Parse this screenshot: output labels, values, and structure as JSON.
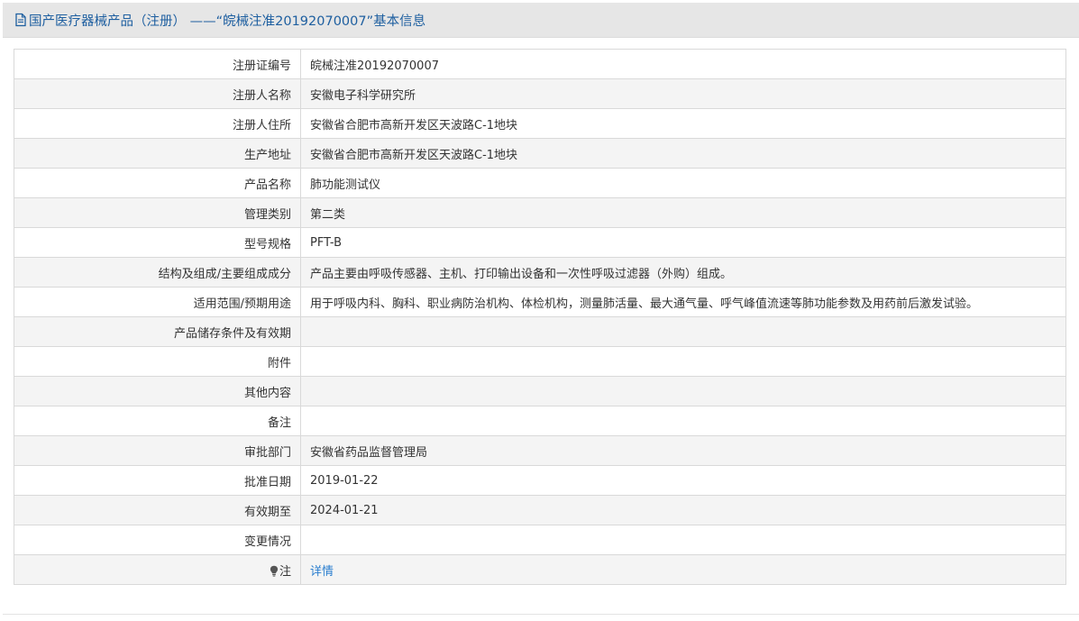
{
  "header": {
    "title": "国产医疗器械产品（注册） ——“皖械注准20192070007”基本信息"
  },
  "rows": [
    {
      "label": "注册证编号",
      "value": "皖械注准20192070007"
    },
    {
      "label": "注册人名称",
      "value": "安徽电子科学研究所"
    },
    {
      "label": "注册人住所",
      "value": "安徽省合肥市高新开发区天波路C-1地块"
    },
    {
      "label": "生产地址",
      "value": "安徽省合肥市高新开发区天波路C-1地块"
    },
    {
      "label": "产品名称",
      "value": "肺功能测试仪"
    },
    {
      "label": "管理类别",
      "value": "第二类"
    },
    {
      "label": "型号规格",
      "value": "PFT-B"
    },
    {
      "label": "结构及组成/主要组成成分",
      "value": "产品主要由呼吸传感器、主机、打印输出设备和一次性呼吸过滤器（外购）组成。"
    },
    {
      "label": "适用范围/预期用途",
      "value": "用于呼吸内科、胸科、职业病防治机构、体检机构，测量肺活量、最大通气量、呼气峰值流速等肺功能参数及用药前后激发试验。"
    },
    {
      "label": "产品储存条件及有效期",
      "value": ""
    },
    {
      "label": "附件",
      "value": ""
    },
    {
      "label": "其他内容",
      "value": ""
    },
    {
      "label": "备注",
      "value": ""
    },
    {
      "label": "审批部门",
      "value": "安徽省药品监督管理局"
    },
    {
      "label": "批准日期",
      "value": "2019-01-22"
    },
    {
      "label": "有效期至",
      "value": "2024-01-21"
    },
    {
      "label": "变更情况",
      "value": ""
    }
  ],
  "note_row": {
    "icon": "lightbulb-icon",
    "label": "注",
    "link_text": "详情"
  },
  "colors": {
    "header_bg": "#e6e6e6",
    "title_color": "#1e5fa0",
    "link_color": "#2a7ecf",
    "stripe_bg": "#f4f4f4",
    "border": "#d9d9d9"
  }
}
